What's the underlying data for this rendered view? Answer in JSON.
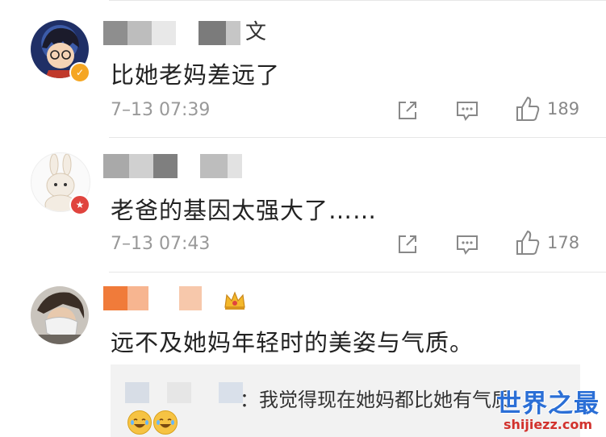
{
  "comments": [
    {
      "name_tail": "文",
      "text": "比她老妈差远了",
      "time": "7–13 07:39",
      "likes": "189",
      "badge": "v-badge-icon",
      "badge_color": "#f5a623"
    },
    {
      "name_tail": "",
      "text": "老爸的基因太强大了……",
      "time": "7–13 07:43",
      "likes": "178",
      "badge": "star-badge-icon",
      "badge_color": "#e0443e"
    },
    {
      "name_tail": "",
      "text": "远不及她妈年轻时的美姿与气质。",
      "crown": "crown-icon"
    }
  ],
  "reply": {
    "text": "：我觉得现在她妈都比她有气质"
  },
  "watermark": {
    "main": "世界之最",
    "sub": "shijiezz.com"
  },
  "colors": {
    "muted": "#999999",
    "reply_bg": "#f2f2f2",
    "watermark_blue": "#2b6fd6",
    "watermark_red": "#d2322d"
  }
}
